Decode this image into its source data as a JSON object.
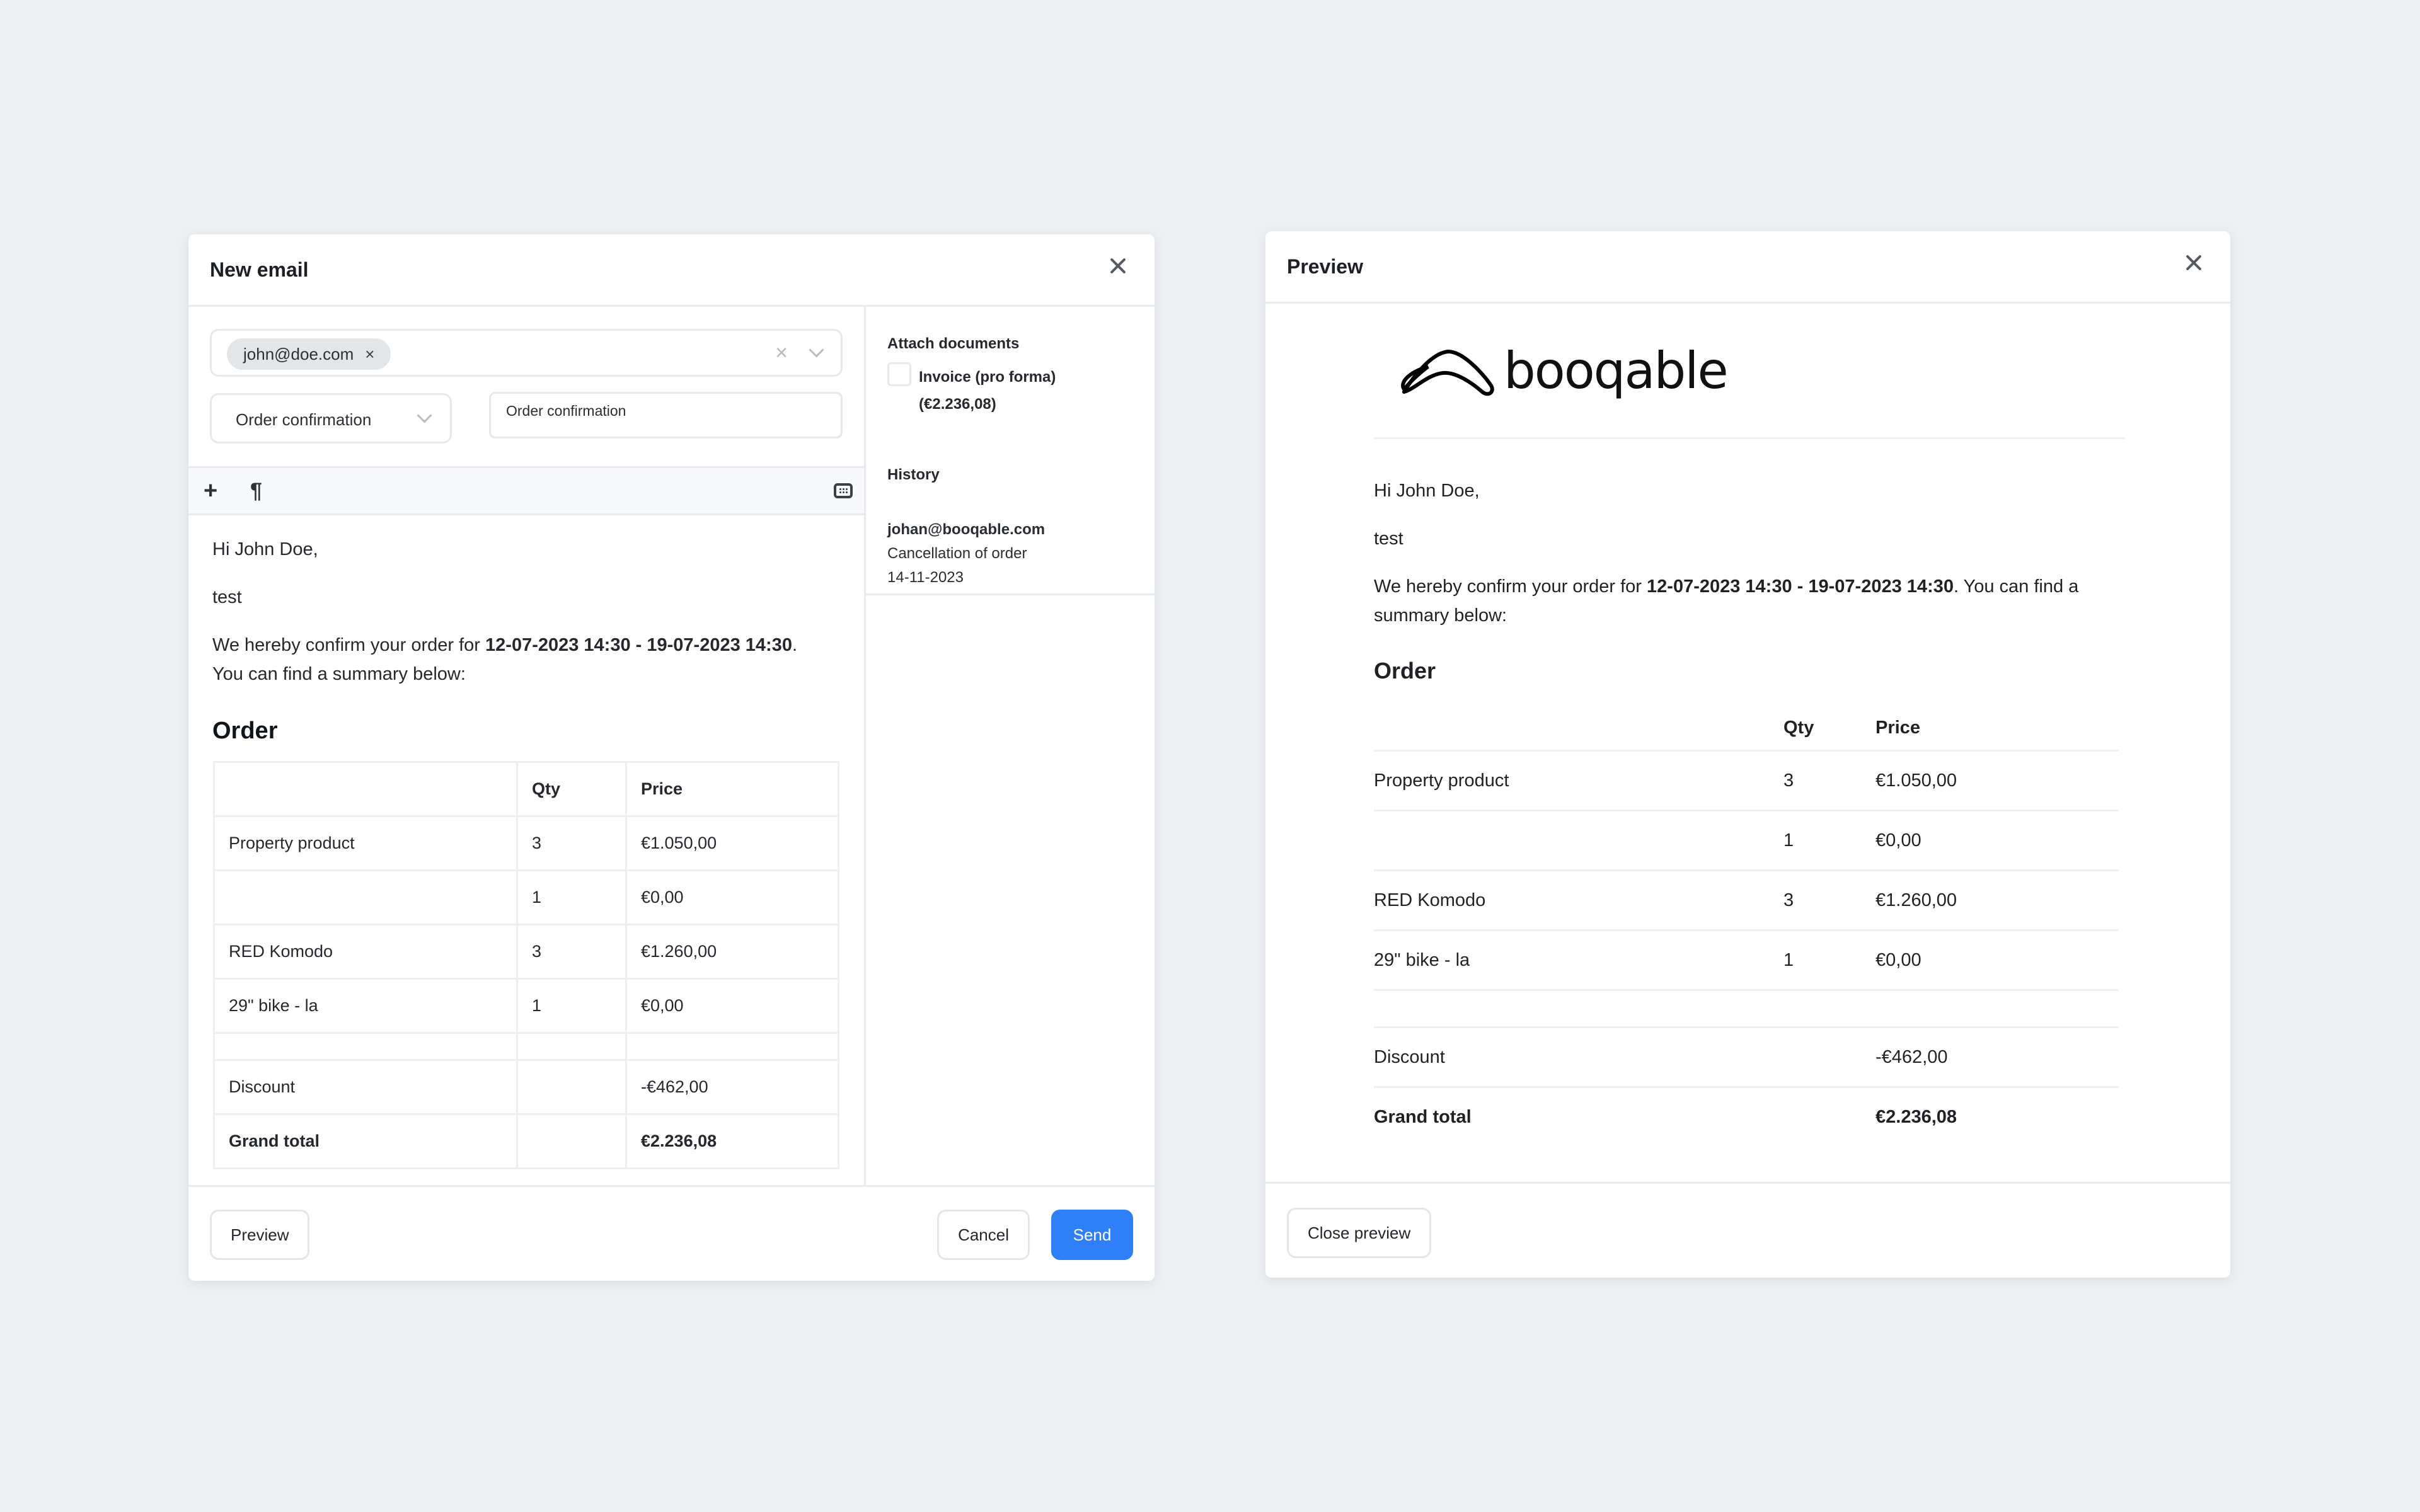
{
  "email_modal": {
    "title": "New email",
    "recipient_chip": "john@doe.com",
    "template_select": "Order confirmation",
    "subject": "Order confirmation",
    "toolbar": {
      "add_icon": "plus-icon",
      "paragraph_icon": "pilcrow-icon",
      "keyboard_icon": "keyboard-icon"
    },
    "body": {
      "greeting": "Hi John Doe,",
      "line2": "test",
      "confirm_prefix": "We hereby confirm your order for ",
      "confirm_dates": "12-07-2023 14:30 - 19-07-2023 14:30",
      "confirm_suffix": ".",
      "summary_line": "You can find a summary below:",
      "order_heading": "Order"
    },
    "table": {
      "headers": [
        "",
        "Qty",
        "Price"
      ],
      "rows": [
        [
          "Property product",
          "3",
          "€1.050,00"
        ],
        [
          "",
          "1",
          "€0,00"
        ],
        [
          "RED Komodo",
          "3",
          "€1.260,00"
        ],
        [
          "29\" bike - la",
          "1",
          "€0,00"
        ]
      ],
      "discount": {
        "label": "Discount",
        "value": "-€462,00"
      },
      "grand_total": {
        "label": "Grand total",
        "value": "€2.236,08"
      }
    },
    "sidebar": {
      "attach_title": "Attach documents",
      "attachment_label_1": "Invoice (pro forma)",
      "attachment_label_2": "(€2.236,08)",
      "attachment_checked": false,
      "history_title": "History",
      "history": [
        {
          "sender": "johan@booqable.com",
          "subject": "Cancellation of order",
          "date": "14-11-2023"
        }
      ]
    },
    "footer": {
      "preview": "Preview",
      "cancel": "Cancel",
      "send": "Send"
    }
  },
  "preview_modal": {
    "title": "Preview",
    "logo_text": "booqable",
    "body": {
      "greeting": "Hi John Doe,",
      "line2": "test",
      "confirm_prefix": "We hereby confirm your order for ",
      "confirm_dates": "12-07-2023 14:30 - 19-07-2023 14:30",
      "confirm_suffix": ". You can find a summary below:",
      "order_heading": "Order"
    },
    "table": {
      "headers": [
        "",
        "Qty",
        "Price"
      ],
      "rows": [
        [
          "Property product",
          "3",
          "€1.050,00"
        ],
        [
          "",
          "1",
          "€0,00"
        ],
        [
          "RED Komodo",
          "3",
          "€1.260,00"
        ],
        [
          "29\" bike - la",
          "1",
          "€0,00"
        ]
      ],
      "discount": {
        "label": "Discount",
        "value": "-€462,00"
      },
      "grand_total": {
        "label": "Grand total",
        "value": "€2.236,08"
      }
    },
    "footer": {
      "close_preview": "Close preview"
    }
  },
  "colors": {
    "primary": "#2f80f8",
    "background": "#edf0f3",
    "border": "#e8eaed"
  }
}
